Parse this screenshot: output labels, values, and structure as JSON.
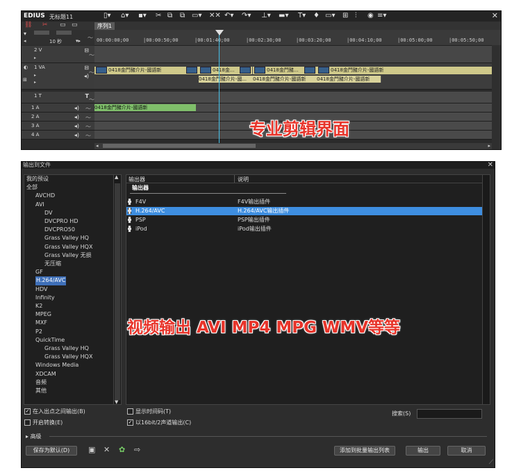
{
  "edius": {
    "app_name": "EDIUS",
    "project_name": "无标题11",
    "sequence_tab": "序列1",
    "zoom_label": "10 秒",
    "timecodes": [
      "00:00:00;00",
      "|00:00:50;00",
      "|00:01:40;00",
      "|00:02:30;00",
      "|00:03:20;00",
      "|00:04:10;00",
      "|00:05:00;00",
      "|00:05:50;00"
    ],
    "tracks": {
      "v2": "2 V",
      "va1": "1 VA",
      "t1": "1 T",
      "a1": "1 A",
      "a2": "2 A",
      "a3": "3 A",
      "a4": "4 A"
    },
    "clips": {
      "v1": "0418金門豬介片-國語新",
      "v2": "0418金...",
      "v3": "0418金門豬...",
      "v4": "0418金門豬介片-國語新",
      "sub1": "0418金門豬介片-國...",
      "sub2": "0418金門豬介片-國語新",
      "sub3": "0418金門豬介片-國語新",
      "audio": "0418金門豬介片-國語新"
    },
    "overlay": "专业剪辑界面"
  },
  "dialog": {
    "title": "输出到文件",
    "tree": [
      {
        "label": "我的预设",
        "level": 0
      },
      {
        "label": "全部",
        "level": 0
      },
      {
        "label": "AVCHD",
        "level": 1
      },
      {
        "label": "AVI",
        "level": 1
      },
      {
        "label": "DV",
        "level": 2
      },
      {
        "label": "DVCPRO HD",
        "level": 2
      },
      {
        "label": "DVCPRO50",
        "level": 2
      },
      {
        "label": "Grass Valley HQ",
        "level": 2
      },
      {
        "label": "Grass Valley HQX",
        "level": 2
      },
      {
        "label": "Grass Valley 无损",
        "level": 2
      },
      {
        "label": "无压缩",
        "level": 2
      },
      {
        "label": "GF",
        "level": 1
      },
      {
        "label": "H.264/AVC",
        "level": 1,
        "selected": true
      },
      {
        "label": "HDV",
        "level": 1
      },
      {
        "label": "Infinity",
        "level": 1
      },
      {
        "label": "K2",
        "level": 1
      },
      {
        "label": "MPEG",
        "level": 1
      },
      {
        "label": "MXF",
        "level": 1
      },
      {
        "label": "P2",
        "level": 1
      },
      {
        "label": "QuickTime",
        "level": 1
      },
      {
        "label": "Grass Valley HQ",
        "level": 2
      },
      {
        "label": "Grass Valley HQX",
        "level": 2
      },
      {
        "label": "Windows Media",
        "level": 1
      },
      {
        "label": "XDCAM",
        "level": 1
      },
      {
        "label": "音频",
        "level": 1
      },
      {
        "label": "其他",
        "level": 1
      }
    ],
    "list_header": {
      "exporter": "输出器",
      "description": "说明"
    },
    "group_label": "输出器",
    "exporters": [
      {
        "name": "F4V",
        "desc": "F4V输出插件",
        "selected": false
      },
      {
        "name": "H.264/AVC",
        "desc": "H.264/AVC输出插件",
        "selected": true
      },
      {
        "name": "PSP",
        "desc": "PSP输出插件",
        "selected": false
      },
      {
        "name": "iPod",
        "desc": "iPod输出插件",
        "selected": false
      }
    ],
    "overlay": "视频输出 AVI MP4 MPG WMV等等",
    "options": {
      "in_out": "在入出点之间输出(B)",
      "enable_convert": "开启转换(E)",
      "show_timecode": "显示时间码(T)",
      "output_16bit": "以16bit/2声道输出(C)",
      "in_out_checked": true,
      "enable_convert_checked": false,
      "show_timecode_checked": false,
      "output_16bit_checked": true
    },
    "search_label": "搜索(S)",
    "search_value": "",
    "advanced": "高级",
    "buttons": {
      "save_default": "保存为默认(D)",
      "add_batch": "添加到批量输出列表",
      "export": "输出",
      "cancel": "取消"
    }
  }
}
